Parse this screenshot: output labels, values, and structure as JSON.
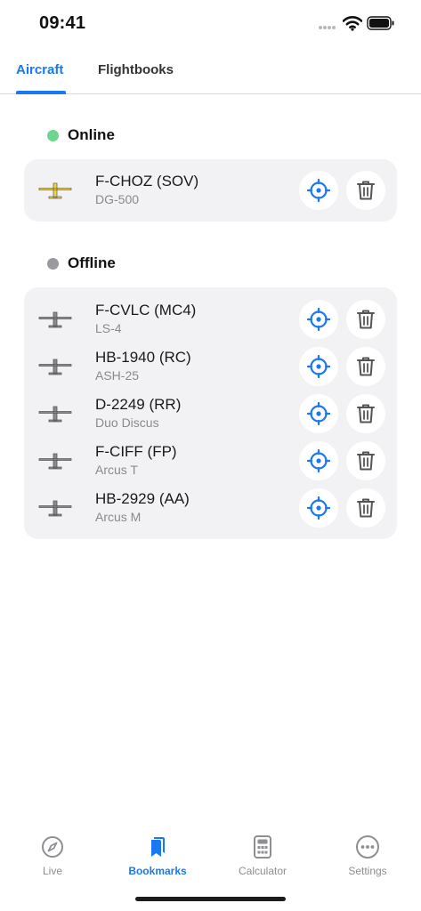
{
  "status_bar": {
    "time": "09:41"
  },
  "tabs": [
    {
      "label": "Aircraft",
      "active": true
    },
    {
      "label": "Flightbooks",
      "active": false
    }
  ],
  "colors": {
    "accent": "#1a78f2",
    "online": "#6fd68f",
    "offline": "#9a9a9e",
    "glider_online": "#f0d340",
    "glider_offline": "#8a8a8a"
  },
  "online": {
    "title": "Online",
    "items": [
      {
        "registration": "F-CHOZ (SOV)",
        "model": "DG-500"
      }
    ]
  },
  "offline": {
    "title": "Offline",
    "items": [
      {
        "registration": "F-CVLC (MC4)",
        "model": "LS-4"
      },
      {
        "registration": "HB-1940 (RC)",
        "model": "ASH-25"
      },
      {
        "registration": "D-2249 (RR)",
        "model": "Duo Discus"
      },
      {
        "registration": "F-CIFF (FP)",
        "model": "Arcus T"
      },
      {
        "registration": "HB-2929 (AA)",
        "model": "Arcus M"
      }
    ]
  },
  "bottom_nav": [
    {
      "label": "Live",
      "icon": "compass-icon",
      "active": false
    },
    {
      "label": "Bookmarks",
      "icon": "bookmarks-icon",
      "active": true
    },
    {
      "label": "Calculator",
      "icon": "calculator-icon",
      "active": false
    },
    {
      "label": "Settings",
      "icon": "more-icon",
      "active": false
    }
  ]
}
